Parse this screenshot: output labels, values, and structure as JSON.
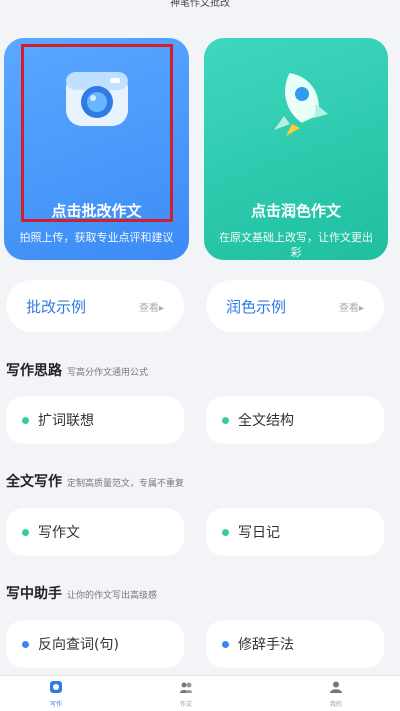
{
  "app": {
    "title": "神笔作文批改"
  },
  "cards": [
    {
      "title": "点击批改作文",
      "subtitle": "拍照上传，获取专业点评和建议",
      "icon": "camera-icon"
    },
    {
      "title": "点击润色作文",
      "subtitle": "在原文基础上改写，让作文更出彩",
      "icon": "rocket-icon"
    }
  ],
  "examples": [
    {
      "label": "批改示例",
      "view": "查看▸"
    },
    {
      "label": "润色示例",
      "view": "查看▸"
    }
  ],
  "sections": [
    {
      "title": "写作思路",
      "subtitle": "写高分作文通用公式",
      "items": [
        "扩词联想",
        "全文结构"
      ]
    },
    {
      "title": "全文写作",
      "subtitle": "定制高质量范文，专属不重复",
      "items": [
        "写作文",
        "写日记"
      ]
    },
    {
      "title": "写中助手",
      "subtitle": "让你的作文写出高级感",
      "items": [
        "反向查词(句)",
        "修辞手法"
      ]
    }
  ],
  "tabs": [
    {
      "label": "写作",
      "icon": "home-icon",
      "active": true
    },
    {
      "label": "作文",
      "icon": "community-icon",
      "active": false
    },
    {
      "label": "我的",
      "icon": "user-icon",
      "active": false
    }
  ],
  "colors": {
    "accent": "#2f7ae5",
    "highlight": "#d0202a",
    "green": "#39c9a6"
  }
}
